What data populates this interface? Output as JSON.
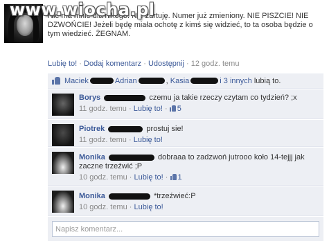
{
  "watermark": "www.wiocha.pl",
  "post": {
    "text": "Nie ma mnie dla nikogo. Nie żartuję. Numer już zmieniony. NIE PISZCIE! NIE DZWOŃCIE! Jeżeli będę miała ochotę z kimś się widzieć, to ta osoba będzie o tym wiedzieć. ŻEGNAM.",
    "like_label": "Lubię to!",
    "comment_label": "Dodaj komentarz",
    "share_label": "Udostępnij",
    "separator": "·",
    "timestamp": "12 godz. temu"
  },
  "likes": {
    "name1": "Maciek",
    "name2": "Adrian",
    "name3": "Kasia",
    "others": "i 3 innych",
    "suffix": "lubią to."
  },
  "comments": [
    {
      "author": "Borys",
      "text": "czemu ja takie rzeczy czytam co tydzień? ;x",
      "time": "11 godz. temu",
      "like_label": "Lubię to!",
      "like_count": "5"
    },
    {
      "author": "Piotrek",
      "text": "prostuj sie!",
      "time": "11 godz. temu",
      "like_label": "Lubię to!",
      "like_count": ""
    },
    {
      "author": "Monika",
      "text": "dobraaa to zadzwoń jutrooo koło 14-tejjj jak zaczne trzeźwić ;P",
      "time": "10 godz. temu",
      "like_label": "Lubię to!",
      "like_count": "1"
    },
    {
      "author": "Monika",
      "text": "*trzeźwieć:P",
      "time": "10 godz. temu",
      "like_label": "Lubię to!",
      "like_count": ""
    }
  ],
  "composer": {
    "placeholder": "Napisz komentarz..."
  },
  "colors": {
    "link": "#3b5998",
    "panel": "#edeff4",
    "muted": "#8a8a8a"
  }
}
